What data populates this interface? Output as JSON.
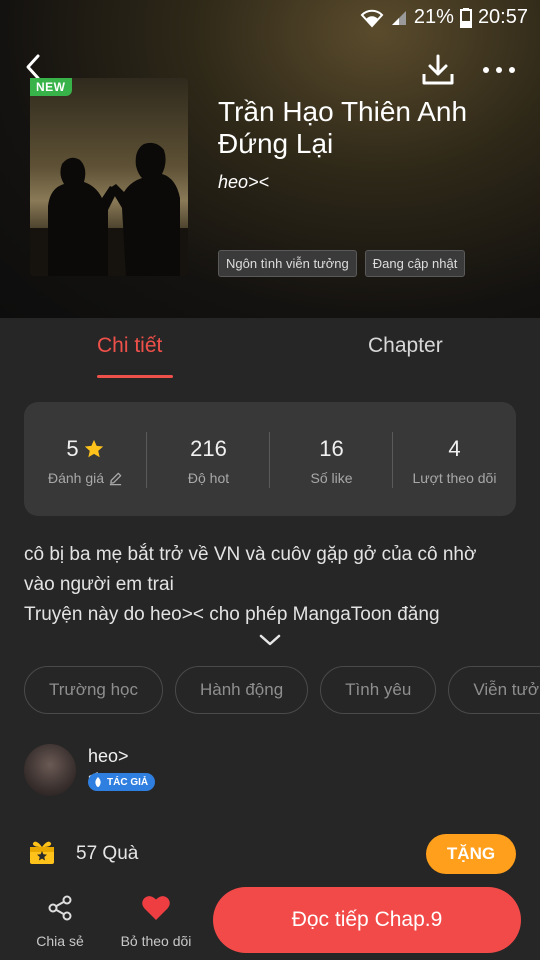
{
  "status_bar": {
    "battery": "21%",
    "time": "20:57"
  },
  "book": {
    "badge": "NEW",
    "title": "Trần Hạo Thiên Anh Đứng Lại",
    "author": "heo><",
    "genres": [
      "Ngôn tình viễn tưởng",
      "Đang cập nhật"
    ]
  },
  "tabs": {
    "detail": "Chi tiết",
    "chapter": "Chapter"
  },
  "stats": {
    "rating": {
      "value": "5",
      "label": "Đánh giá"
    },
    "hot": {
      "value": "216",
      "label": "Độ hot"
    },
    "likes": {
      "value": "16",
      "label": "Số like"
    },
    "follows": {
      "value": "4",
      "label": "Lượt theo dõi"
    }
  },
  "description": {
    "line1": "cô bị ba mẹ bắt trở về VN và cuôv gặp gở của cô nhờ",
    "line2": "vào người em trai",
    "line3": "Truyện này do heo>< cho phép MangaToon đăng"
  },
  "topics": [
    "Trường học",
    "Hành động",
    "Tình yêu",
    "Viễn tưởng"
  ],
  "author_section": {
    "name": "heo><",
    "badge": "TÁC GIẢ"
  },
  "gifts": {
    "count": "57",
    "unit": "Quà",
    "button": "TẶNG"
  },
  "bottom": {
    "share": "Chia sẻ",
    "follow": "Bỏ theo dõi",
    "read": "Đọc tiếp Chap.9"
  },
  "colors": {
    "accent": "#f0504a",
    "gift_button": "#ff9f1c",
    "read_button": "#f24a48",
    "new_badge": "#37b34a",
    "author_badge": "#2f7fe0"
  }
}
